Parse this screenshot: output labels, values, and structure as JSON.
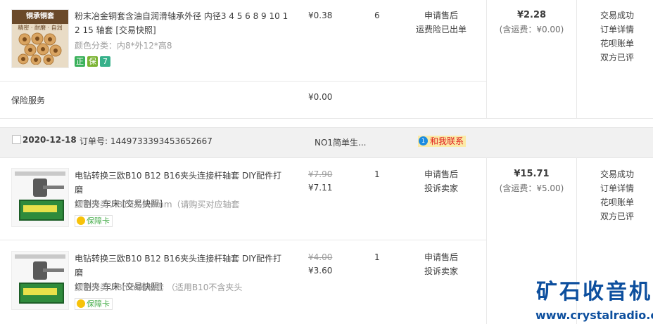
{
  "item1": {
    "title": "粉末冶金铜套含油自润滑轴承外径 内径3 4 5 6 8 9 10 1",
    "title2": "2 15 轴套 [交易快照]",
    "variant": "颜色分类：内8*外12*高8",
    "price": "¥0.38",
    "qty": "6",
    "action1": "申请售后",
    "action2": "运费险已出单",
    "badges": [
      "正",
      "保",
      "7"
    ],
    "thumb_label": "铜承铜套",
    "thumb_sub": "精密 · 耐磨 · 自润"
  },
  "insurance": {
    "label": "保险服务",
    "price": "¥0.00"
  },
  "order1": {
    "total": "¥2.28",
    "shipping": "(含运费：¥0.00)",
    "status": [
      "交易成功",
      "订单详情",
      "花呗账单",
      "双方已评"
    ]
  },
  "order2_header": {
    "date": "2020-12-18",
    "order_no": "订单号: 1449733393453652667",
    "shop": "NO1简单生...",
    "contact": "和我联系",
    "contact_icon": "chat-bubble"
  },
  "item2": {
    "title": "电钻转换三欧B10 B12 B16夹头连接杆轴套 DIY配件打磨",
    "title2": "切割夹 车床 [交易快照]",
    "variant": "颜色分类：B10夹头6mm（请购买对应轴套",
    "price_old": "¥7.90",
    "price": "¥7.11",
    "qty": "1",
    "action1": "申请售后",
    "action2": "投诉卖家",
    "badge": "保障卡"
  },
  "item3": {
    "title": "电钻转换三欧B10 B12 B16夹头连接杆轴套 DIY配件打磨",
    "title2": "切割夹 车床 [交易快照]",
    "variant": "颜色分类：8mm尾轴套 （适用B10不含夹头",
    "price_old": "¥4.00",
    "price": "¥3.60",
    "qty": "1",
    "action1": "申请售后",
    "action2": "投诉卖家",
    "badge": "保障卡"
  },
  "order2": {
    "total": "¥15.71",
    "shipping": "(含运费：¥5.00)",
    "status": [
      "交易成功",
      "订单详情",
      "花呗账单",
      "双方已评"
    ]
  },
  "watermark": {
    "line1": "矿石收音机",
    "line2": "www.crystalradio.cn"
  }
}
